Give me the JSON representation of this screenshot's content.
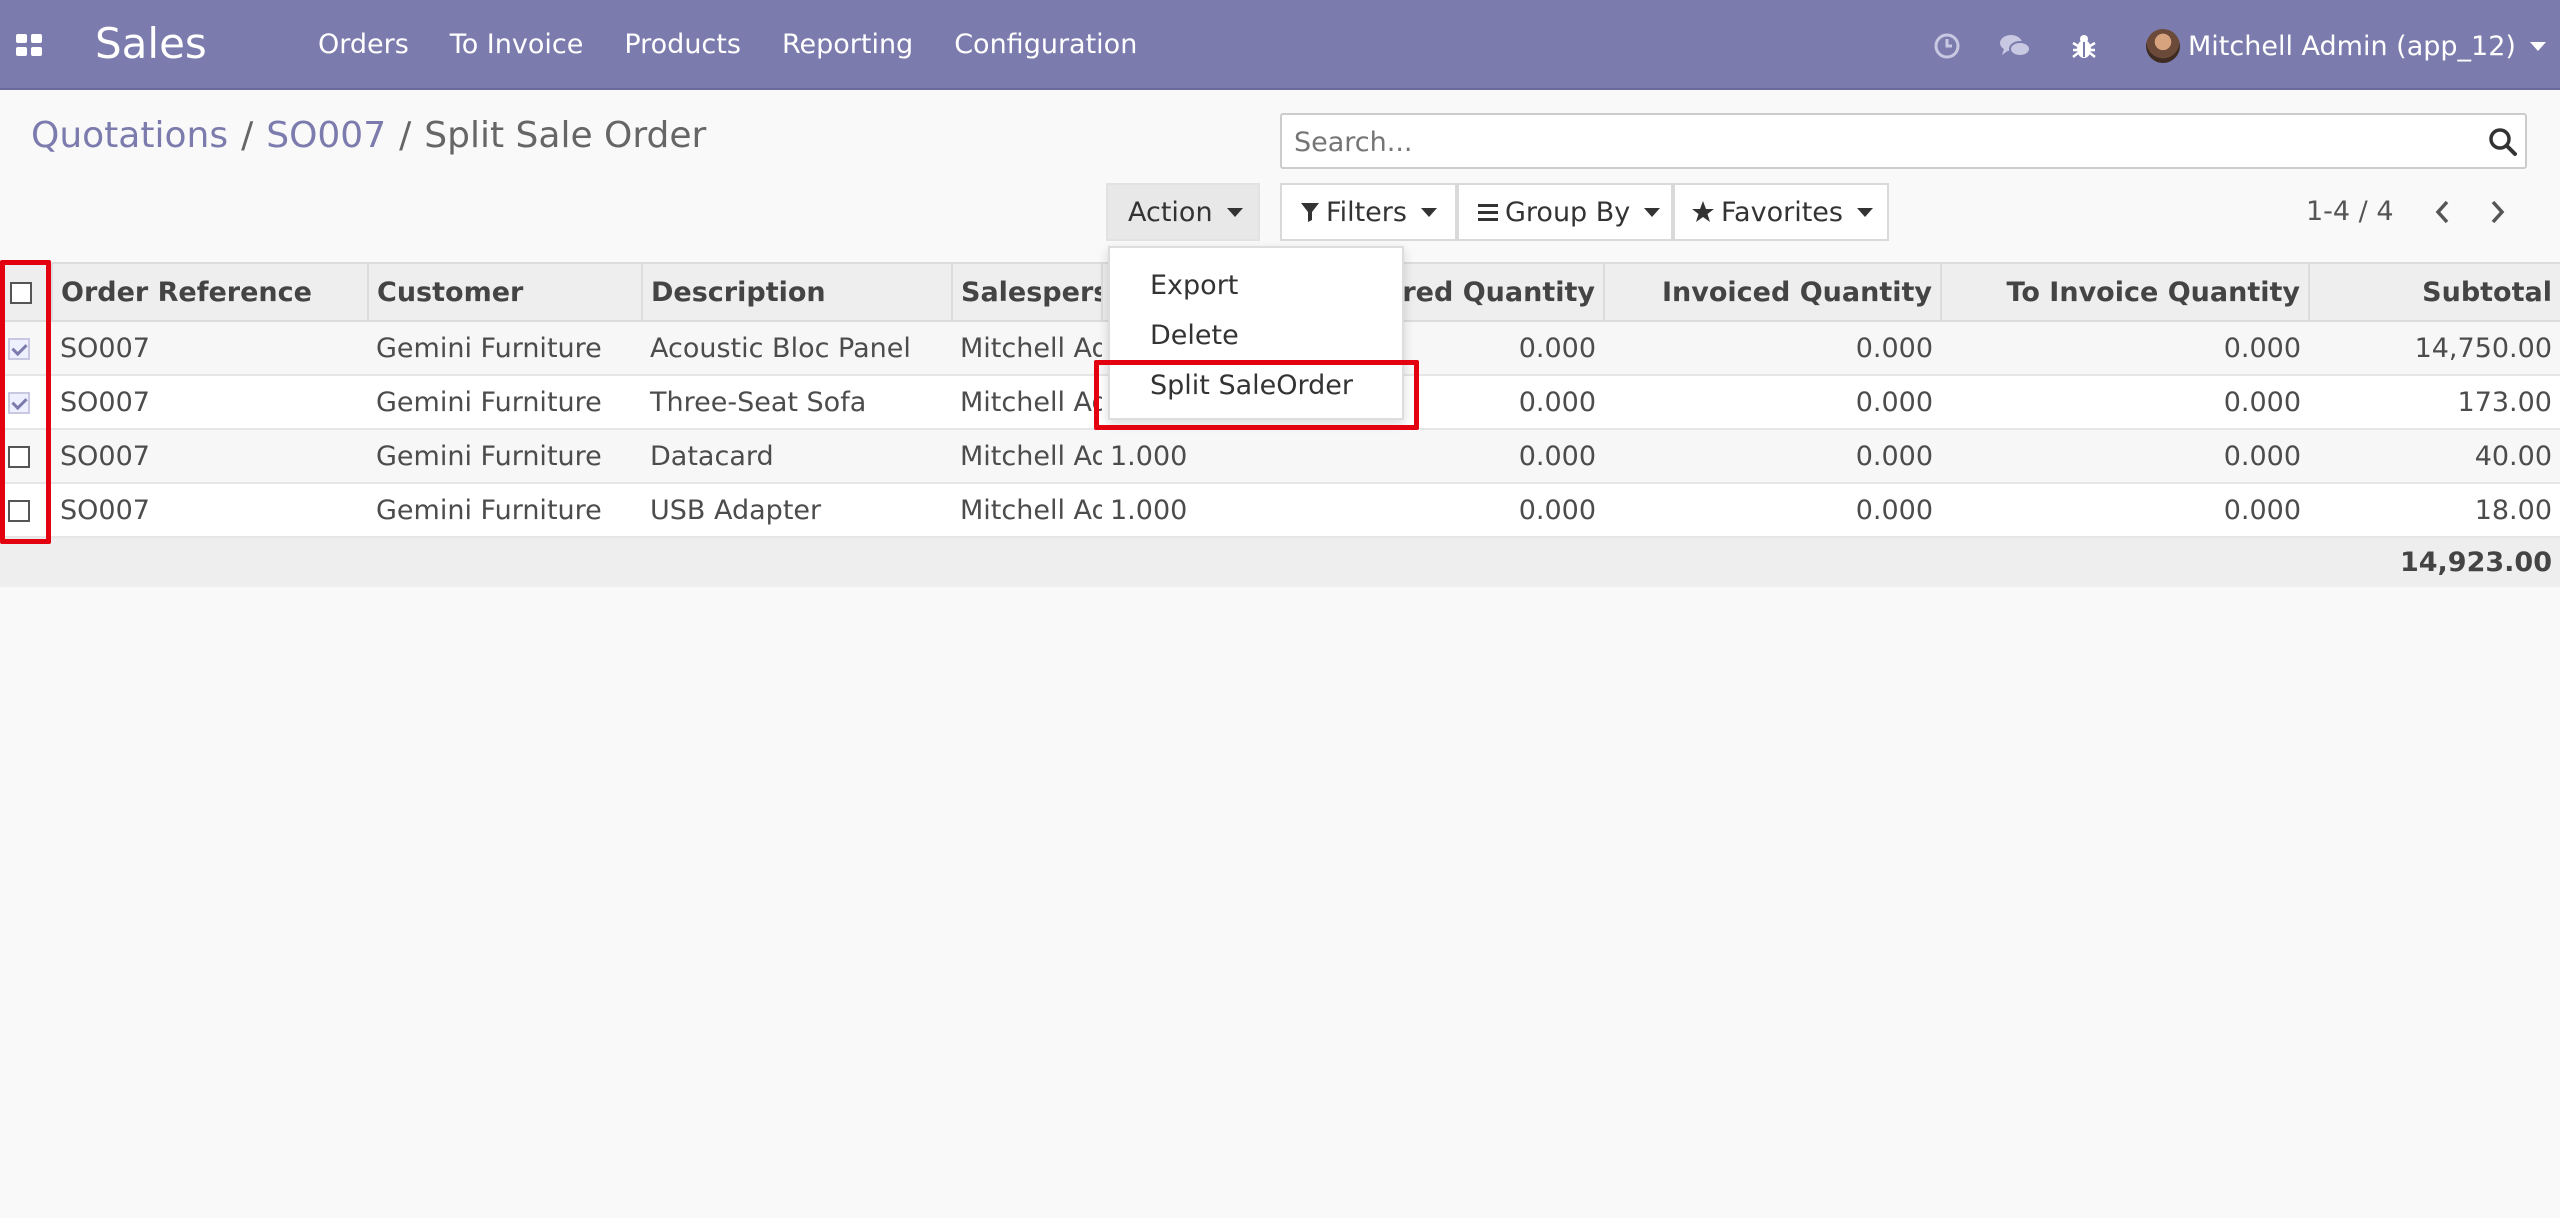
{
  "navbar": {
    "brand": "Sales",
    "menu": [
      "Orders",
      "To Invoice",
      "Products",
      "Reporting",
      "Configuration"
    ],
    "user": "Mitchell Admin (app_12)",
    "icons": [
      "apps-icon",
      "clock-icon",
      "chat-icon",
      "bug-icon"
    ]
  },
  "breadcrumb": {
    "items": [
      "Quotations",
      "SO007"
    ],
    "separator": "/",
    "current": "Split Sale Order"
  },
  "search": {
    "placeholder": "Search..."
  },
  "toolbar": {
    "action_label": "Action",
    "filters_label": "Filters",
    "group_by_label": "Group By",
    "favorites_label": "Favorites"
  },
  "pager": {
    "value": "1-4 / 4"
  },
  "action_menu": {
    "items": [
      "Export",
      "Delete",
      "Split SaleOrder"
    ],
    "highlighted": "Split SaleOrder"
  },
  "table": {
    "columns": [
      "Order Reference",
      "Customer",
      "Description",
      "Salesperson",
      "Delivered Quantity",
      "Invoiced Quantity",
      "To Invoice Quantity",
      "Subtotal"
    ],
    "rows": [
      {
        "selected": true,
        "ref": "SO007",
        "customer": "Gemini Furniture",
        "description": "Acoustic Bloc Panel",
        "salesperson": "Mitchell Admin",
        "qty": "",
        "delivered": "0.000",
        "invoiced": "0.000",
        "to_invoice": "0.000",
        "subtotal": "14,750.00"
      },
      {
        "selected": true,
        "ref": "SO007",
        "customer": "Gemini Furniture",
        "description": "Three-Seat Sofa",
        "salesperson": "Mitchell Admin",
        "qty": "",
        "delivered": "0.000",
        "invoiced": "0.000",
        "to_invoice": "0.000",
        "subtotal": "173.00"
      },
      {
        "selected": false,
        "ref": "SO007",
        "customer": "Gemini Furniture",
        "description": "Datacard",
        "salesperson": "Mitchell Admin",
        "qty": "1.000",
        "delivered": "0.000",
        "invoiced": "0.000",
        "to_invoice": "0.000",
        "subtotal": "40.00"
      },
      {
        "selected": false,
        "ref": "SO007",
        "customer": "Gemini Furniture",
        "description": "USB Adapter",
        "salesperson": "Mitchell Admin",
        "qty": "1.000",
        "delivered": "0.000",
        "invoiced": "0.000",
        "to_invoice": "0.000",
        "subtotal": "18.00"
      }
    ],
    "total": "14,923.00"
  },
  "colors": {
    "brand": "#7c7bad",
    "highlight": "#e3000f"
  }
}
